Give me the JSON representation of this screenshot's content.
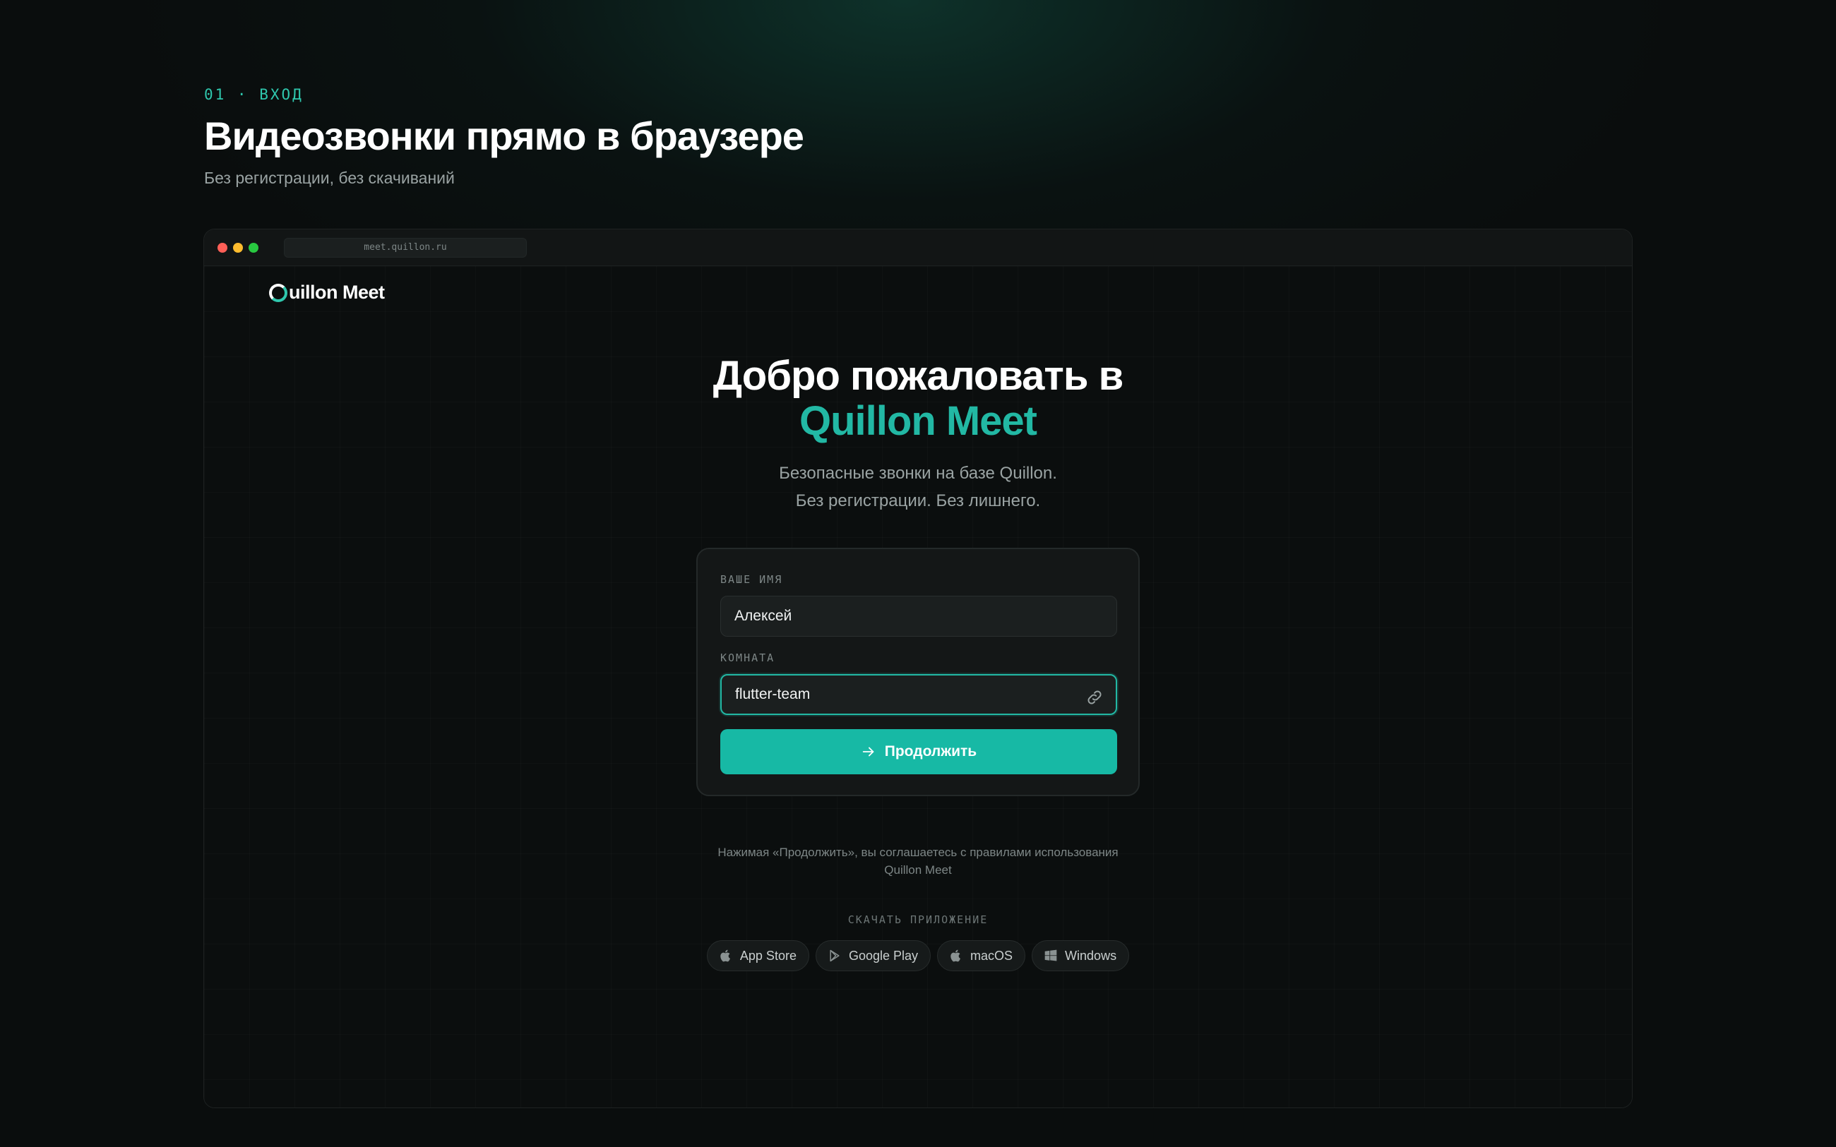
{
  "header": {
    "eyebrow": "01 · ВХОД",
    "title": "Видеозвонки прямо в браузере",
    "subtitle": "Без регистрации, без скачиваний"
  },
  "browser": {
    "url": "meet.quillon.ru"
  },
  "app": {
    "logo_text": "uillon Meet",
    "welcome_line1": "Добро пожаловать в",
    "welcome_line2": "Quillon Meet",
    "welcome_sub_line1": "Безопасные звонки на базе Quillon.",
    "welcome_sub_line2": "Без регистрации. Без лишнего."
  },
  "form": {
    "name_label": "ВАШЕ ИМЯ",
    "name_value": "Алексей",
    "room_label": "КОМНАТА",
    "room_value": "flutter-team",
    "room_icon": "link-icon",
    "submit_label": "Продолжить",
    "submit_icon": "arrow-right-icon"
  },
  "terms": {
    "line1": "Нажимая «Продолжить», вы соглашаетесь с правилами использования",
    "line2": "Quillon Meet"
  },
  "download": {
    "label": "СКАЧАТЬ ПРИЛОЖЕНИЕ",
    "stores": [
      {
        "label": "App Store",
        "icon": "apple-icon"
      },
      {
        "label": "Google Play",
        "icon": "play-icon"
      },
      {
        "label": "macOS",
        "icon": "apple-icon"
      },
      {
        "label": "Windows",
        "icon": "windows-icon"
      }
    ]
  },
  "colors": {
    "accent": "#22b8a4",
    "button": "#17b9a5",
    "background": "#0a0d0d"
  }
}
